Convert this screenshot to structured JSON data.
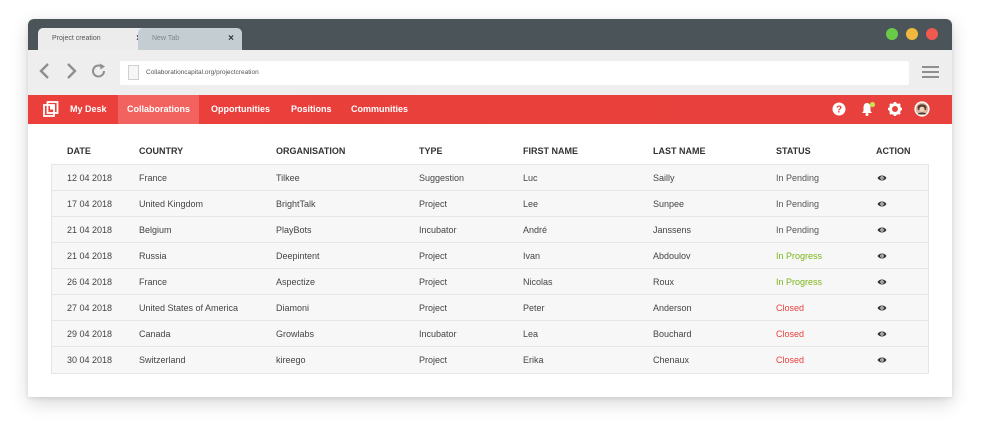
{
  "browser": {
    "tabs": [
      {
        "title": "Project creation",
        "close": "×"
      },
      {
        "title": "New Tab",
        "close": "×"
      }
    ],
    "url": "Collaborationcapital.org/projectcreation",
    "window_buttons": {
      "green": "#6bc94a",
      "yellow": "#f2b83e",
      "red": "#ee5a4f"
    }
  },
  "nav": {
    "items": [
      "My Desk",
      "Collaborations",
      "Opportunities",
      "Positions",
      "Communities"
    ],
    "active": "Collaborations",
    "accent": "#e8403c",
    "icons": [
      "logo-icon",
      "help-icon",
      "notification-icon",
      "settings-icon",
      "avatar"
    ]
  },
  "table": {
    "headers": [
      "DATE",
      "COUNTRY",
      "ORGANISATION",
      "TYPE",
      "FIRST NAME",
      "LAST NAME",
      "STATUS",
      "ACTION"
    ],
    "rows": [
      {
        "date": "12 04 2018",
        "country": "France",
        "organisation": "Tilkee",
        "type": "Suggestion",
        "first": "Luc",
        "last": "Sailly",
        "status": "In Pending"
      },
      {
        "date": "17 04 2018",
        "country": "United Kingdom",
        "organisation": "BrightTalk",
        "type": "Project",
        "first": "Lee",
        "last": "Sunpee",
        "status": "In Pending"
      },
      {
        "date": "21 04 2018",
        "country": "Belgium",
        "organisation": "PlayBots",
        "type": "Incubator",
        "first": "André",
        "last": "Janssens",
        "status": "In Pending"
      },
      {
        "date": "21 04 2018",
        "country": "Russia",
        "organisation": "Deepintent",
        "type": "Project",
        "first": "Ivan",
        "last": "Abdoulov",
        "status": "In Progress"
      },
      {
        "date": "26 04 2018",
        "country": "France",
        "organisation": "Aspectize",
        "type": "Project",
        "first": "Nicolas",
        "last": "Roux",
        "status": "In Progress"
      },
      {
        "date": "27 04 2018",
        "country": "United States of America",
        "organisation": "Diamoni",
        "type": "Project",
        "first": "Peter",
        "last": "Anderson",
        "status": "Closed"
      },
      {
        "date": "29 04 2018",
        "country": "Canada",
        "organisation": "Growlabs",
        "type": "Incubator",
        "first": "Lea",
        "last": "Bouchard",
        "status": "Closed"
      },
      {
        "date": "30 04 2018",
        "country": "Switzerland",
        "organisation": "kireego",
        "type": "Project",
        "first": "Erika",
        "last": "Chenaux",
        "status": "Closed"
      }
    ],
    "status_colors": {
      "In Pending": "#555555",
      "In Progress": "#7cb518",
      "Closed": "#e8403c"
    },
    "action_icon": "eye-icon"
  }
}
